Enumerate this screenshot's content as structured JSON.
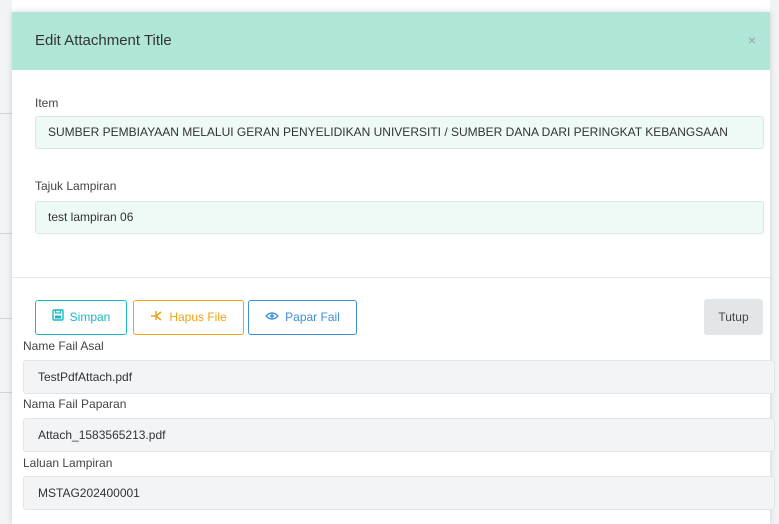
{
  "modal": {
    "title": "Edit Attachment Title",
    "close_glyph": "×"
  },
  "fields": {
    "item_label": "Item",
    "item_value": "SUMBER PEMBIAYAAN MELALUI GERAN PENYELIDIKAN UNIVERSITI / SUMBER DANA DARI PERINGKAT  KEBANGSAAN",
    "tajuk_label": "Tajuk Lampiran",
    "tajuk_value": "test lampiran 06"
  },
  "buttons": {
    "simpan": "Simpan",
    "hapus": "Hapus File",
    "papar": "Papar Fail",
    "tutup": "Tutup"
  },
  "info": {
    "asal_label": "Name Fail Asal",
    "asal_value": "TestPdfAttach.pdf",
    "paparan_label": "Nama Fail Paparan",
    "paparan_value": "Attach_1583565213.pdf",
    "laluan_label": "Laluan Lampiran",
    "laluan_value": "MSTAG202400001"
  },
  "colors": {
    "header_bg": "#b0e6d8",
    "simpan": "#19b8c4",
    "hapus": "#f2a216",
    "papar": "#3d8fd9"
  }
}
